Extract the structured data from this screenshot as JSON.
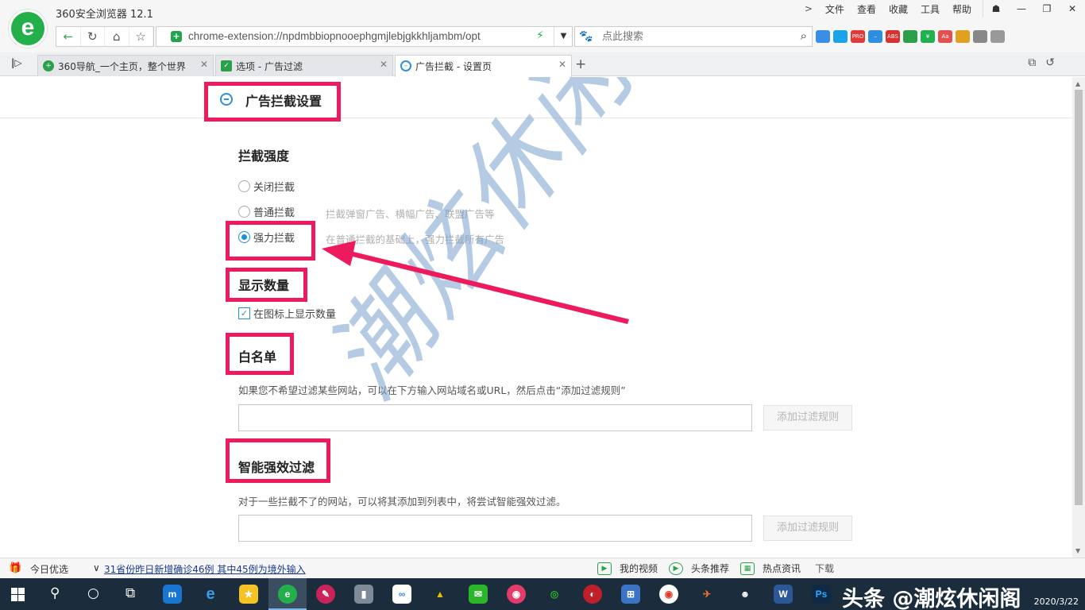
{
  "browser": {
    "title": "360安全浏览器 12.1",
    "menu": [
      "文件",
      "查看",
      "收藏",
      "工具",
      "帮助"
    ],
    "address": "chrome-extension://npdmbbiopnooephgmjlebjgkkhljambm/opt",
    "search_placeholder": "点此搜索",
    "tabs": [
      {
        "label": "360导航_一个主页，整个世界",
        "icon_color": "#2aa04a"
      },
      {
        "label": "选项 - 广告过滤",
        "icon_color": "#2aa04a"
      },
      {
        "label": "广告拦截 - 设置页",
        "icon_color": "#2e8ee0"
      }
    ]
  },
  "settings": {
    "header_title": "广告拦截设置",
    "strength": {
      "title": "拦截强度",
      "options": [
        {
          "label": "关闭拦截",
          "desc": "",
          "checked": false
        },
        {
          "label": "普通拦截",
          "desc": "拦截弹窗广告、横幅广告、联盟广告等",
          "checked": false
        },
        {
          "label": "强力拦截",
          "desc": "在普通拦截的基础上，强力拦截所有广告",
          "checked": true
        }
      ]
    },
    "count": {
      "title": "显示数量",
      "checkbox_label": "在图标上显示数量",
      "checked": true
    },
    "whitelist": {
      "title": "白名单",
      "desc": "如果您不希望过滤某些网站，可以在下方输入网站域名或URL，然后点击“添加过滤规则”",
      "button": "添加过滤规则"
    },
    "smart": {
      "title": "智能强效过滤",
      "desc": "对于一些拦截不了的网站，可以将其添加到列表中，将尝试智能强效过滤。",
      "button": "添加过滤规则"
    }
  },
  "annotation_color": "#ee1a5e",
  "watermark": "潮炫休闲阁",
  "statusbar": {
    "today": "今日优选",
    "news": "31省份昨日新增确诊46例 其中45例为境外输入",
    "items": [
      "我的视频",
      "头条推荐",
      "热点资讯"
    ],
    "far": "下载"
  },
  "taskbar": {
    "watermark": "头条 @潮炫休闲阁",
    "date": "2020/3/22"
  }
}
